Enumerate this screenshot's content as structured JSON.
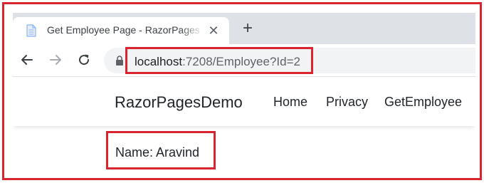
{
  "browser": {
    "tab": {
      "title": "Get Employee Page - RazorPages",
      "close_glyph": "✕",
      "icon": "document-icon"
    },
    "new_tab_glyph": "+",
    "address_bar": {
      "host": "localhost",
      "rest": ":7208/Employee?Id=2"
    }
  },
  "page": {
    "brand": "RazorPagesDemo",
    "nav": {
      "home": "Home",
      "privacy": "Privacy",
      "get_employee": "GetEmployee"
    },
    "employee_name": "Name: Aravind"
  },
  "colors": {
    "highlight": "#d9252f",
    "tabstrip": "#dee1e6",
    "omnibox": "#f1f3f4"
  }
}
